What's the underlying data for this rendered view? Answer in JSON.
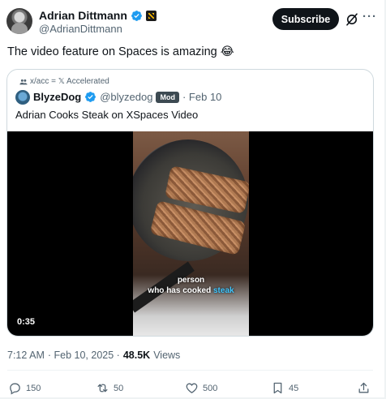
{
  "author": {
    "display_name": "Adrian Dittmann",
    "handle": "@AdrianDittmann"
  },
  "header": {
    "subscribe_label": "Subscribe",
    "more_label": "···"
  },
  "post": {
    "text": "The video feature on Spaces is amazing 😂"
  },
  "quote": {
    "community_label": "x/acc = 𝕏 Accelerated",
    "display_name": "BlyzeDog",
    "handle": "@blyzedog",
    "badge": "Mod",
    "date": "· Feb 10",
    "text": "Adrian Cooks Steak on XSpaces Video",
    "video": {
      "caption_line1": "person",
      "caption_line2_a": "who has cooked ",
      "caption_line2_b": "steak",
      "duration": "0:35"
    }
  },
  "meta": {
    "time": "7:12 AM",
    "date": "· Feb 10, 2025 ·",
    "views_count": "48.5K",
    "views_label": "Views"
  },
  "actions": {
    "replies": "150",
    "reposts": "50",
    "likes": "500",
    "bookmarks": "45"
  },
  "colors": {
    "verified": "#1d9bf0",
    "text_secondary": "#536471",
    "caption_highlight": "#3ec6ff"
  }
}
